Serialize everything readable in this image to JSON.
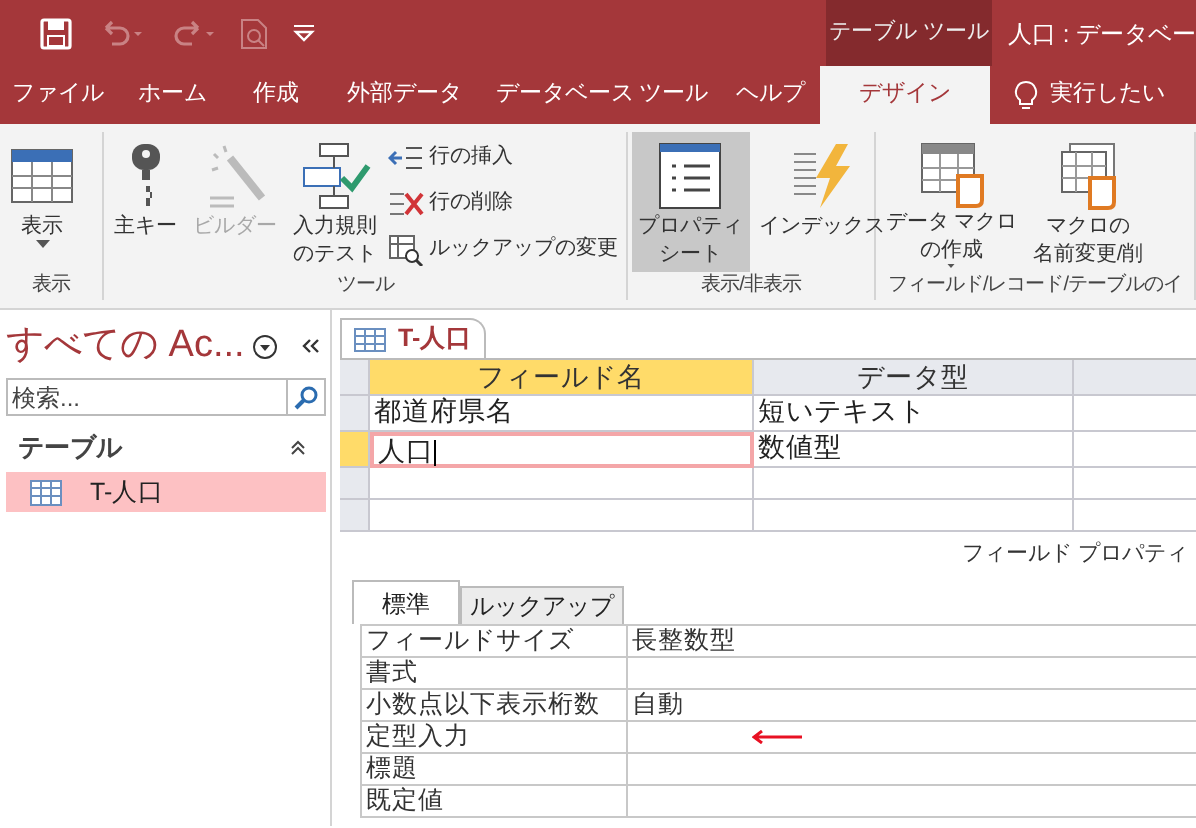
{
  "quick_access": [
    {
      "kind": "save",
      "disabled": false
    },
    {
      "kind": "undo",
      "disabled": true
    },
    {
      "kind": "redo",
      "disabled": true
    },
    {
      "kind": "preview",
      "disabled": true
    },
    {
      "kind": "customize",
      "disabled": false
    }
  ],
  "context_label": "テーブル ツール",
  "window": {
    "title": "人口 : データベー"
  },
  "tabs": [
    {
      "label": "ファイル",
      "selected": false
    },
    {
      "label": "ホーム",
      "selected": false
    },
    {
      "label": "作成",
      "selected": false
    },
    {
      "label": "外部データ",
      "selected": false
    },
    {
      "label": "データベース ツール",
      "selected": false
    },
    {
      "label": "ヘルプ",
      "selected": false
    },
    {
      "label": "デザイン",
      "selected": true
    }
  ],
  "tell_me": "実行したい",
  "ribbon_groups": [
    {
      "label": "表示",
      "buttons": [
        {
          "kind": "large",
          "lines": [
            "表示"
          ],
          "dropdown": true,
          "disabled": false,
          "selected": false
        }
      ]
    },
    {
      "label": "ツール",
      "buttons": [
        {
          "kind": "large",
          "lines": [
            "主キー"
          ],
          "dropdown": false,
          "disabled": false,
          "selected": false
        },
        {
          "kind": "large",
          "lines": [
            "ビルダー"
          ],
          "dropdown": false,
          "disabled": true,
          "selected": false
        },
        {
          "kind": "large",
          "lines": [
            "入力規則",
            "のテスト"
          ],
          "dropdown": false,
          "disabled": false,
          "selected": false
        },
        {
          "kind": "small",
          "items": [
            {
              "label": "行の挿入"
            },
            {
              "label": "行の削除"
            },
            {
              "label": "ルックアップの変更"
            }
          ]
        }
      ]
    },
    {
      "label": "表示/非表示",
      "buttons": [
        {
          "kind": "large",
          "lines": [
            "プロパティ",
            "シート"
          ],
          "dropdown": false,
          "disabled": false,
          "selected": true
        },
        {
          "kind": "large",
          "lines": [
            "インデックス"
          ],
          "dropdown": false,
          "disabled": false,
          "selected": false
        }
      ]
    },
    {
      "label": "フィールド/レコード/テーブルのイ",
      "buttons": [
        {
          "kind": "large",
          "lines": [
            "データ マクロ",
            "の作成"
          ],
          "dropdown": true,
          "disabled": false,
          "selected": false
        },
        {
          "kind": "large",
          "lines": [
            "マクロの",
            "名前変更/削"
          ],
          "dropdown": false,
          "disabled": false,
          "selected": false
        }
      ]
    }
  ],
  "nav": {
    "title": "すべての Ac...",
    "search": {
      "placeholder": "検索..."
    },
    "group": "テーブル",
    "items": [
      {
        "label": "T-人口",
        "selected": true
      }
    ]
  },
  "document_tab": "T-人口",
  "design_grid": {
    "columns": [
      "フィールド名",
      "データ型"
    ],
    "rows": [
      {
        "field": "都道府県名",
        "type": "短いテキスト",
        "selected": false
      },
      {
        "field": "人口",
        "type": "数値型",
        "selected": true
      }
    ]
  },
  "field_properties": {
    "title": "フィールド プロパティ",
    "tabs": [
      {
        "label": "標準",
        "selected": true
      },
      {
        "label": "ルックアップ",
        "selected": false
      }
    ],
    "rows": [
      {
        "name": "フィールドサイズ",
        "value": "長整数型"
      },
      {
        "name": "書式",
        "value": ""
      },
      {
        "name": "小数点以下表示桁数",
        "value": "自動"
      },
      {
        "name": "定型入力",
        "value": "",
        "arrow": true
      },
      {
        "name": "標題",
        "value": ""
      },
      {
        "name": "既定値",
        "value": ""
      }
    ]
  }
}
